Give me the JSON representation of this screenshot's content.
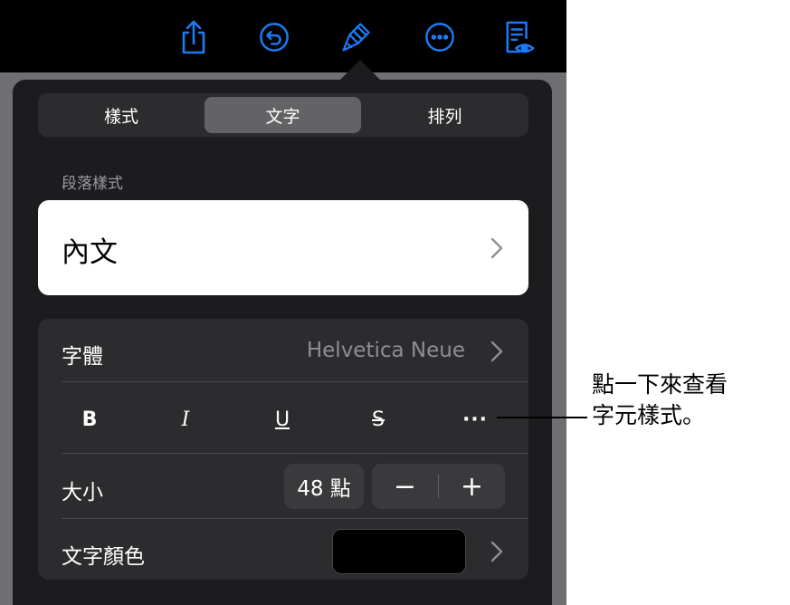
{
  "toolbar": {
    "icons": [
      "share-icon",
      "undo-icon",
      "format-brush-icon",
      "more-icon",
      "reading-view-icon"
    ],
    "accent_color": "#1a7cf5"
  },
  "tabs": [
    {
      "label": "樣式",
      "active": false
    },
    {
      "label": "文字",
      "active": true
    },
    {
      "label": "排列",
      "active": false
    }
  ],
  "paragraph": {
    "section_label": "段落樣式",
    "style_name": "內文"
  },
  "font": {
    "label": "字體",
    "value": "Helvetica Neue"
  },
  "format_buttons": {
    "bold": "B",
    "italic": "I",
    "underline": "U",
    "strikethrough": "S",
    "more": "···"
  },
  "size": {
    "label": "大小",
    "value": "48 點",
    "decrement": "−",
    "increment": "+"
  },
  "text_color": {
    "label": "文字顏色",
    "swatch_color": "#000000"
  },
  "callout": {
    "line1": "點一下來查看",
    "line2": "字元樣式。"
  }
}
